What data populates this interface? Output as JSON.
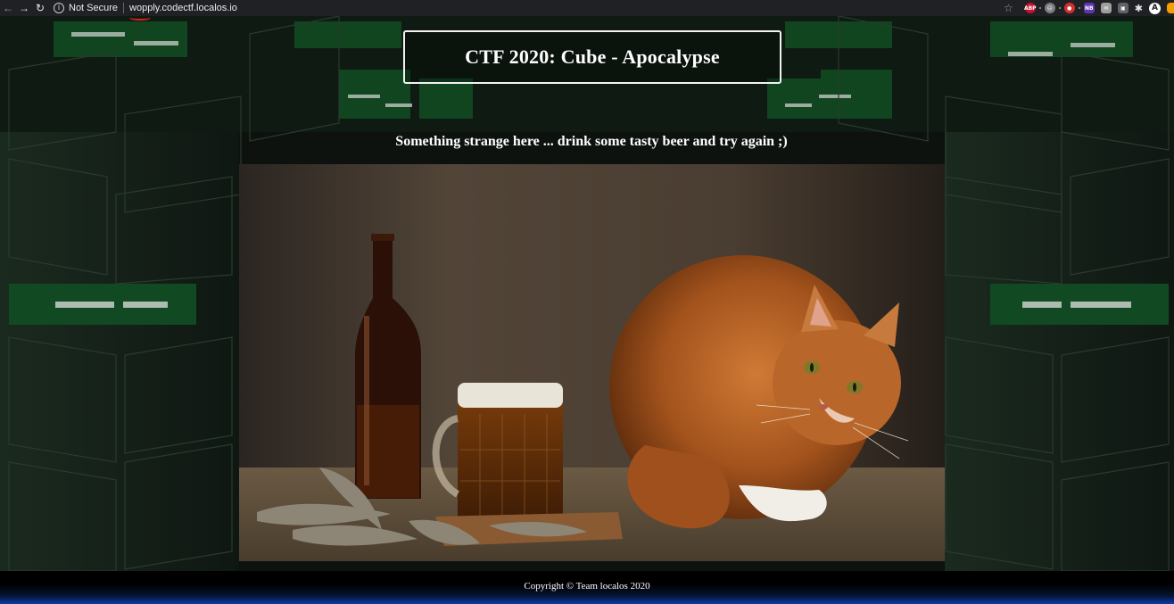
{
  "browser": {
    "security_label": "Not Secure",
    "url": "wopply.codectf.localos.io",
    "extensions": [
      {
        "name": "adblock-plus-icon",
        "label": "ABP"
      },
      {
        "name": "sad-face-extension-icon",
        "label": ""
      },
      {
        "name": "red-extension-icon",
        "label": ""
      },
      {
        "name": "nb-extension-icon",
        "label": "NB"
      },
      {
        "name": "mail-extension-icon",
        "label": ""
      },
      {
        "name": "screen-extension-icon",
        "label": ""
      }
    ],
    "profile_initial": "A"
  },
  "page": {
    "title": "CTF 2020: Cube - Apocalypse",
    "message": "Something strange here ... drink some tasty beer and try again ;)",
    "photo_subject": "",
    "footer": "Copyright © Team localos 2020"
  },
  "colors": {
    "toolbar_bg": "#202124",
    "page_bg": "#101512",
    "title_border": "#f2f2f2",
    "footer_accent": "#0b3aa8"
  }
}
